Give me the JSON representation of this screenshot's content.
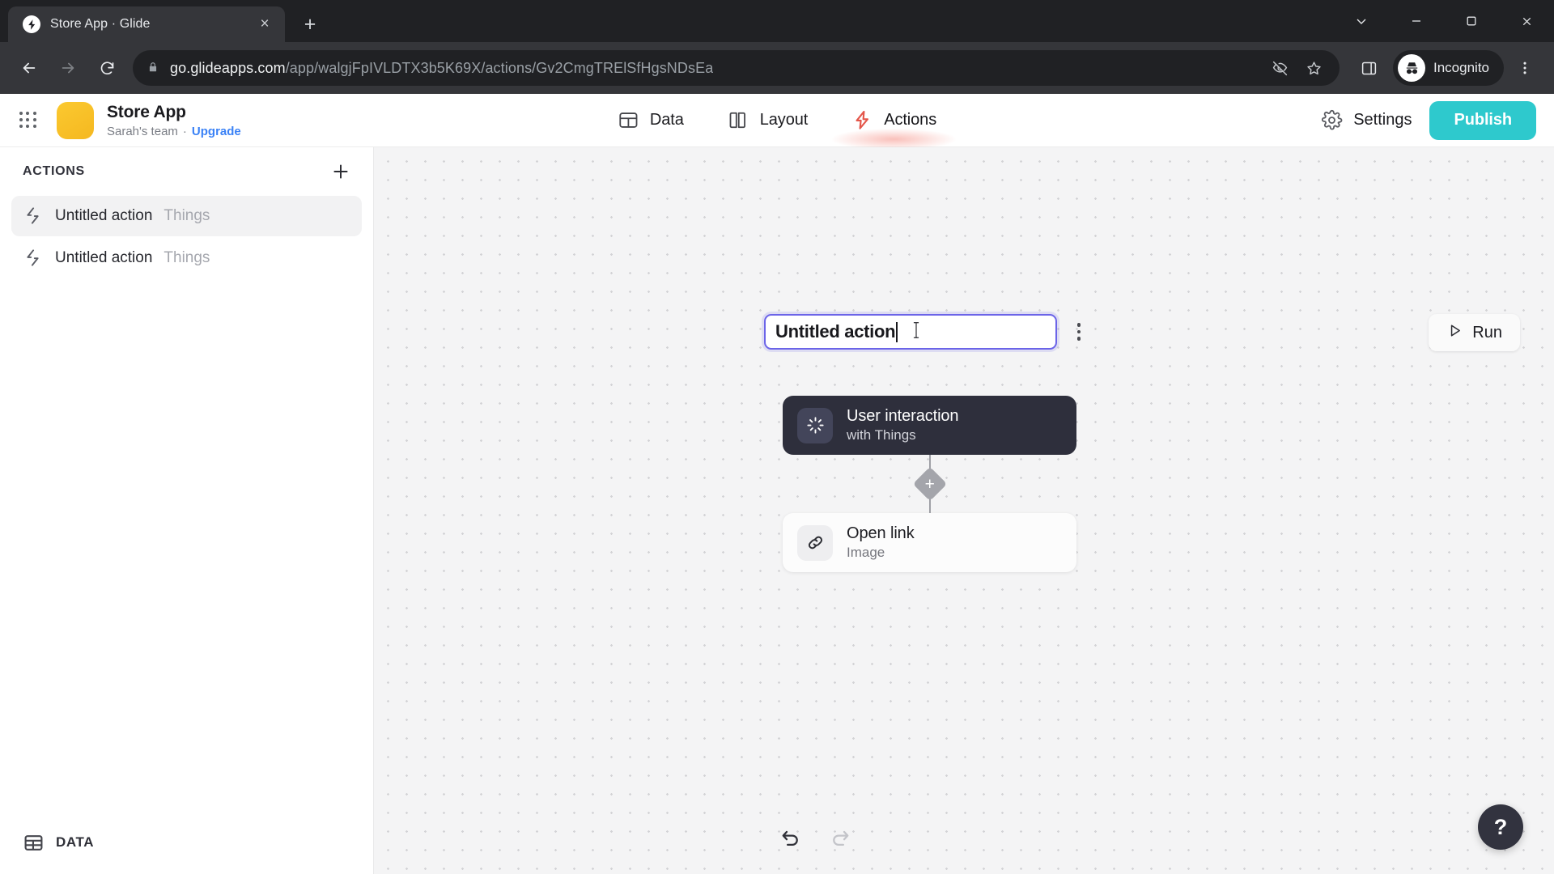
{
  "browser": {
    "tab": {
      "title": "Store App · Glide",
      "favicon": "glide-bolt-icon",
      "close": "×"
    },
    "new_tab": "+",
    "window_controls": {
      "minimize_all": "⌄",
      "minimize": "–",
      "maximize": "▢",
      "close": "✕"
    },
    "nav": {
      "back": "back-icon",
      "forward": "forward-icon",
      "reload": "reload-icon"
    },
    "omnibox": {
      "lock": "lock-icon",
      "host": "go.glideapps.com",
      "path": "/app/walgjFpIVLDTX3b5K69X/actions/Gv2CmgTRElSfHgsNDsEa",
      "full_url": "go.glideapps.com/app/walgjFpIVLDTX3b5K69X/actions/Gv2CmgTRElSfHgsNDsEa",
      "tracking_protection": "eye-off-icon",
      "bookmark": "star-icon"
    },
    "side_panel": "side-panel-icon",
    "profile": {
      "label": "Incognito",
      "avatar": "incognito-avatar-icon"
    },
    "menu": "three-dot-menu-icon"
  },
  "app_header": {
    "apps_grid": "apps-grid-icon",
    "app_icon_color": "#f7c02a",
    "title": "Store App",
    "team": "Sarah's team",
    "separator": "·",
    "upgrade": "Upgrade",
    "upgrade_color": "#3b82f6",
    "tabs": [
      {
        "label": "Data",
        "icon": "data-table-icon",
        "active": false
      },
      {
        "label": "Layout",
        "icon": "layout-panels-icon",
        "active": false
      },
      {
        "label": "Actions",
        "icon": "actions-bolt-icon",
        "active": true
      }
    ],
    "settings": {
      "label": "Settings",
      "icon": "gear-icon"
    },
    "publish": {
      "label": "Publish",
      "color": "#2ec9cd"
    }
  },
  "sidebar": {
    "heading": "ACTIONS",
    "add_button": "+",
    "items": [
      {
        "name": "Untitled action",
        "table": "Things",
        "icon": "actions-bolt-icon",
        "selected": true
      },
      {
        "name": "Untitled action",
        "table": "Things",
        "icon": "actions-bolt-icon",
        "selected": false
      }
    ],
    "footer": {
      "label": "DATA",
      "icon": "data-table-icon"
    }
  },
  "editor": {
    "title_input": {
      "value": "Untitled action",
      "placeholder": "Untitled action",
      "focused": true,
      "focus_color": "#6b64e8"
    },
    "options_menu": "kebab-menu-icon",
    "run_button": {
      "label": "Run",
      "icon": "play-icon"
    },
    "flow": {
      "nodes": [
        {
          "title": "User interaction",
          "subtitle": "with Things",
          "icon": "tap-burst-icon",
          "theme": "dark"
        },
        {
          "title": "Open link",
          "subtitle": "Image",
          "icon": "link-chain-icon",
          "theme": "light"
        }
      ],
      "add_step": "+"
    },
    "undo": {
      "icon": "undo-icon",
      "enabled": true
    },
    "redo": {
      "icon": "redo-icon",
      "enabled": false
    },
    "help": {
      "label": "?"
    }
  }
}
